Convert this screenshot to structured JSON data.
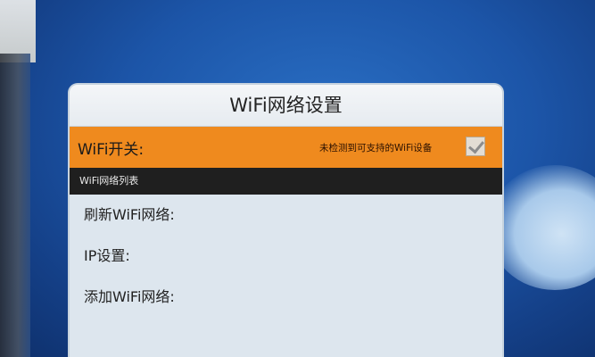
{
  "dialog": {
    "title": "WiFi网络设置",
    "wifi_switch": {
      "label": "WiFi开关:",
      "status": "未检测到可支持的WiFi设备",
      "checked": true
    },
    "section_header": "WiFi网络列表",
    "items": [
      {
        "label": "刷新WiFi网络:"
      },
      {
        "label": "IP设置:"
      },
      {
        "label": "添加WiFi网络:"
      }
    ]
  },
  "colors": {
    "highlight_orange": "#ef8a1e",
    "section_dark": "#1f1f1f",
    "dialog_bg": "#dde6ee",
    "screen_blue": "#1c55a8"
  }
}
